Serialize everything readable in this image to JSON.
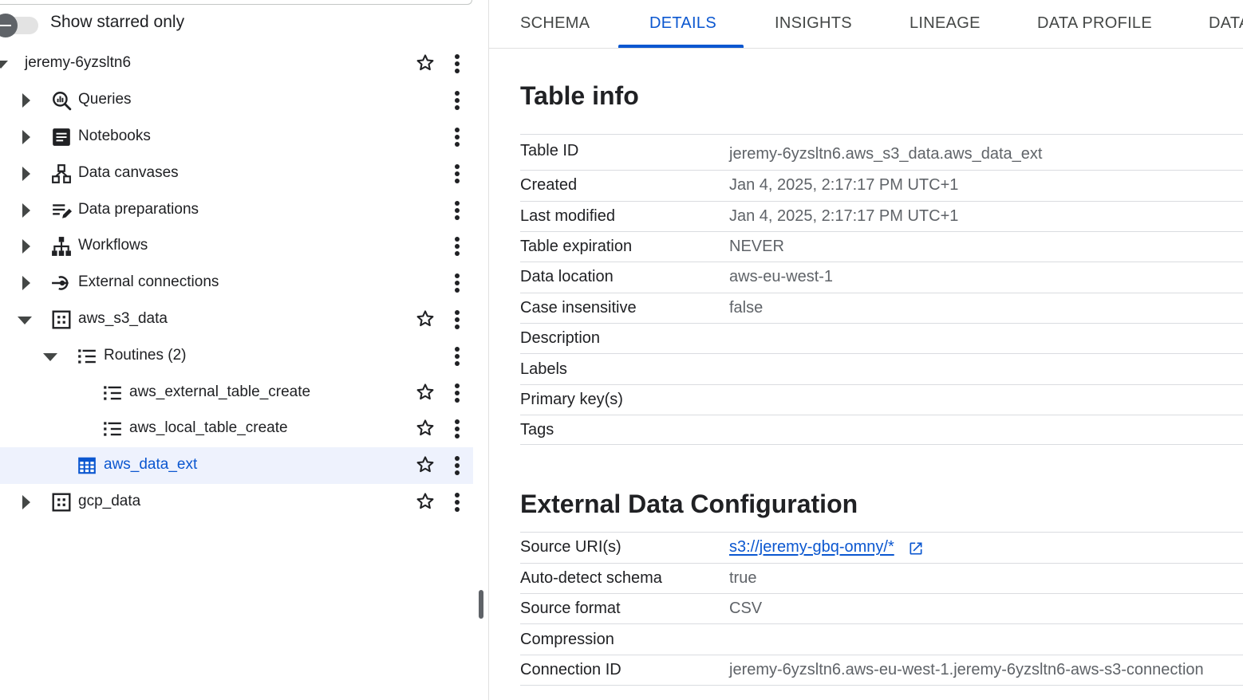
{
  "explorer": {
    "show_starred_label": "Show starred only",
    "show_starred_on": false,
    "project": "jeremy-6yzsltn6",
    "items": [
      {
        "label": "Queries",
        "icon": "queries-icon"
      },
      {
        "label": "Notebooks",
        "icon": "notebook-icon"
      },
      {
        "label": "Data canvases",
        "icon": "data-canvas-icon"
      },
      {
        "label": "Data preparations",
        "icon": "data-preparation-icon"
      },
      {
        "label": "Workflows",
        "icon": "workflow-icon"
      },
      {
        "label": "External connections",
        "icon": "external-connection-icon"
      }
    ],
    "dataset": "aws_s3_data",
    "routines_label": "Routines (2)",
    "routines": [
      "aws_external_table_create",
      "aws_local_table_create"
    ],
    "table": "aws_data_ext",
    "dataset2": "gcp_data"
  },
  "tabs": [
    "SCHEMA",
    "DETAILS",
    "INSIGHTS",
    "LINEAGE",
    "DATA PROFILE",
    "DATA"
  ],
  "active_tab": "DETAILS",
  "table_info": {
    "title": "Table info",
    "rows": [
      {
        "key": "Table ID",
        "value": "jeremy-6yzsltn6.aws_s3_data.aws_data_ext"
      },
      {
        "key": "Created",
        "value": "Jan 4, 2025, 2:17:17 PM UTC+1"
      },
      {
        "key": "Last modified",
        "value": "Jan 4, 2025, 2:17:17 PM UTC+1"
      },
      {
        "key": "Table expiration",
        "value": "NEVER"
      },
      {
        "key": "Data location",
        "value": "aws-eu-west-1"
      },
      {
        "key": "Case insensitive",
        "value": "false"
      },
      {
        "key": "Description",
        "value": ""
      },
      {
        "key": "Labels",
        "value": ""
      },
      {
        "key": "Primary key(s)",
        "value": ""
      },
      {
        "key": "Tags",
        "value": ""
      }
    ]
  },
  "external_config": {
    "title": "External Data Configuration",
    "rows": [
      {
        "key": "Source URI(s)",
        "value": "s3://jeremy-gbq-omny/*"
      },
      {
        "key": "Auto-detect schema",
        "value": "true"
      },
      {
        "key": "Source format",
        "value": "CSV"
      },
      {
        "key": "Compression",
        "value": ""
      },
      {
        "key": "Connection ID",
        "value": "jeremy-6yzsltn6.aws-eu-west-1.jeremy-6yzsltn6-aws-s3-connection"
      }
    ]
  },
  "colors": {
    "accent": "#0b57d0",
    "selected_bg": "#eef2fd",
    "text": "#202124",
    "muted": "#5f6368"
  }
}
